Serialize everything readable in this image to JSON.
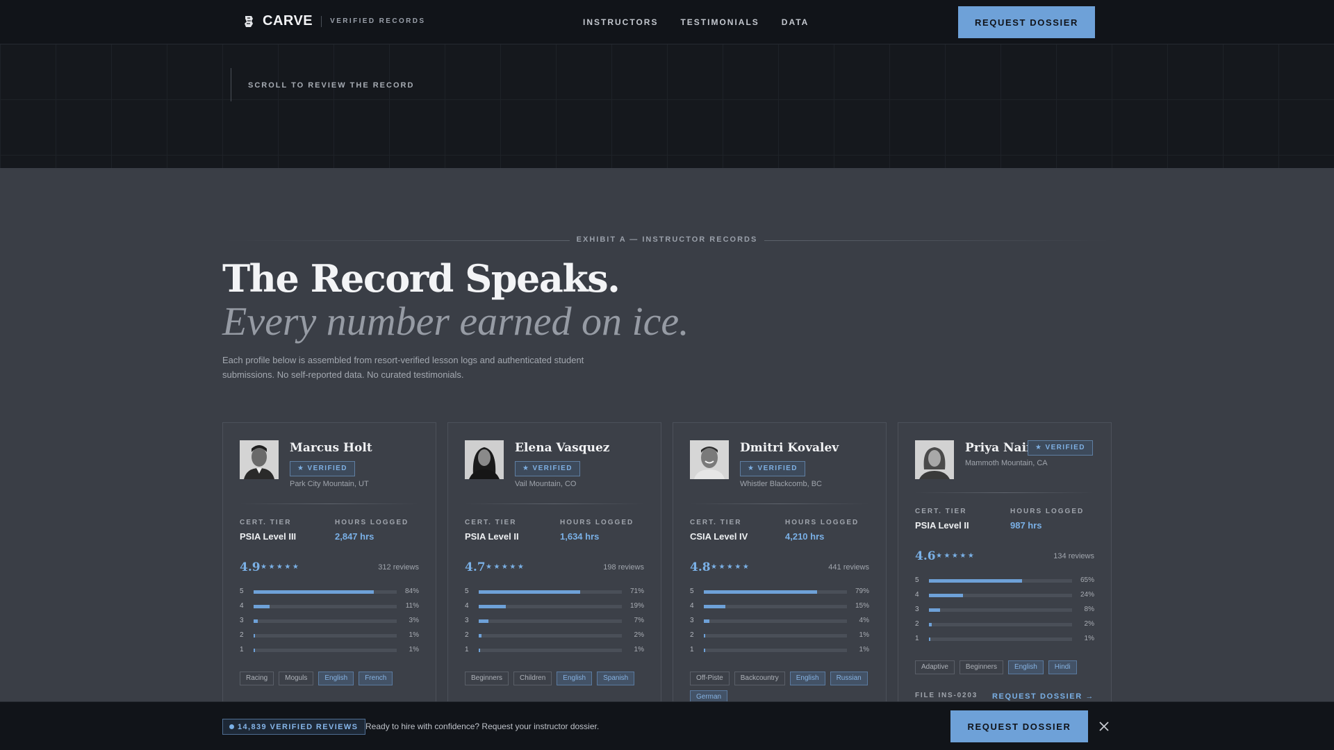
{
  "nav": {
    "brand": "CARVE",
    "tagline": "VERIFIED RECORDS",
    "links": [
      "INSTRUCTORS",
      "TESTIMONIALS",
      "DATA"
    ],
    "cta": "REQUEST DOSSIER"
  },
  "hero": {
    "scroll_hint": "SCROLL TO REVIEW THE RECORD"
  },
  "section": {
    "exhibit": "EXHIBIT A — INSTRUCTOR RECORDS",
    "headline": "The Record Speaks.",
    "subhead": "Every number earned on ice.",
    "intro": "Each profile below is assembled from resort-verified lesson logs and authenticated student submissions. No self-reported data. No curated testimonials."
  },
  "labels": {
    "cert": "CERT. TIER",
    "hours": "HOURS LOGGED",
    "verified": "★ VERIFIED",
    "stars": "★★★★★",
    "dossier_link": "REQUEST DOSSIER →"
  },
  "colors": {
    "accent": "#6ea1d8",
    "nav_bg": "#111419",
    "page_bg": "#3a3e46"
  },
  "instructors": [
    {
      "name": "Marcus Holt",
      "location": "Park City Mountain, UT",
      "cert": "PSIA Level III",
      "hours": "2,847 hrs",
      "rating": "4.9",
      "reviews": "312 reviews",
      "dist": [
        {
          "n": "5",
          "pct": 84,
          "label": "84%"
        },
        {
          "n": "4",
          "pct": 11,
          "label": "11%"
        },
        {
          "n": "3",
          "pct": 3,
          "label": "3%"
        },
        {
          "n": "2",
          "pct": 1,
          "label": "1%"
        },
        {
          "n": "1",
          "pct": 1,
          "label": "1%"
        }
      ],
      "tags": [
        "Racing",
        "Moguls"
      ],
      "langs": [
        "English",
        "French"
      ]
    },
    {
      "name": "Elena Vasquez",
      "location": "Vail Mountain, CO",
      "cert": "PSIA Level II",
      "hours": "1,634 hrs",
      "rating": "4.7",
      "reviews": "198 reviews",
      "dist": [
        {
          "n": "5",
          "pct": 71,
          "label": "71%"
        },
        {
          "n": "4",
          "pct": 19,
          "label": "19%"
        },
        {
          "n": "3",
          "pct": 7,
          "label": "7%"
        },
        {
          "n": "2",
          "pct": 2,
          "label": "2%"
        },
        {
          "n": "1",
          "pct": 1,
          "label": "1%"
        }
      ],
      "tags": [
        "Beginners",
        "Children"
      ],
      "langs": [
        "English",
        "Spanish"
      ]
    },
    {
      "name": "Dmitri Kovalev",
      "location": "Whistler Blackcomb, BC",
      "cert": "CSIA Level IV",
      "hours": "4,210 hrs",
      "rating": "4.8",
      "reviews": "441 reviews",
      "dist": [
        {
          "n": "5",
          "pct": 79,
          "label": "79%"
        },
        {
          "n": "4",
          "pct": 15,
          "label": "15%"
        },
        {
          "n": "3",
          "pct": 4,
          "label": "4%"
        },
        {
          "n": "2",
          "pct": 1,
          "label": "1%"
        },
        {
          "n": "1",
          "pct": 1,
          "label": "1%"
        }
      ],
      "tags": [
        "Off-Piste",
        "Backcountry"
      ],
      "langs": [
        "English",
        "Russian",
        "German"
      ]
    },
    {
      "name": "Priya Nair",
      "location": "Mammoth Mountain, CA",
      "cert": "PSIA Level II",
      "hours": "987 hrs",
      "rating": "4.6",
      "reviews": "134 reviews",
      "dist": [
        {
          "n": "5",
          "pct": 65,
          "label": "65%"
        },
        {
          "n": "4",
          "pct": 24,
          "label": "24%"
        },
        {
          "n": "3",
          "pct": 8,
          "label": "8%"
        },
        {
          "n": "2",
          "pct": 2,
          "label": "2%"
        },
        {
          "n": "1",
          "pct": 1,
          "label": "1%"
        }
      ],
      "tags": [
        "Adaptive",
        "Beginners"
      ],
      "langs": [
        "English",
        "Hindi"
      ],
      "file_id": "FILE INS-0203"
    }
  ],
  "sticky": {
    "count": "14,839 VERIFIED REVIEWS",
    "message": "Ready to hire with confidence? Request your instructor dossier.",
    "cta": "REQUEST DOSSIER"
  }
}
